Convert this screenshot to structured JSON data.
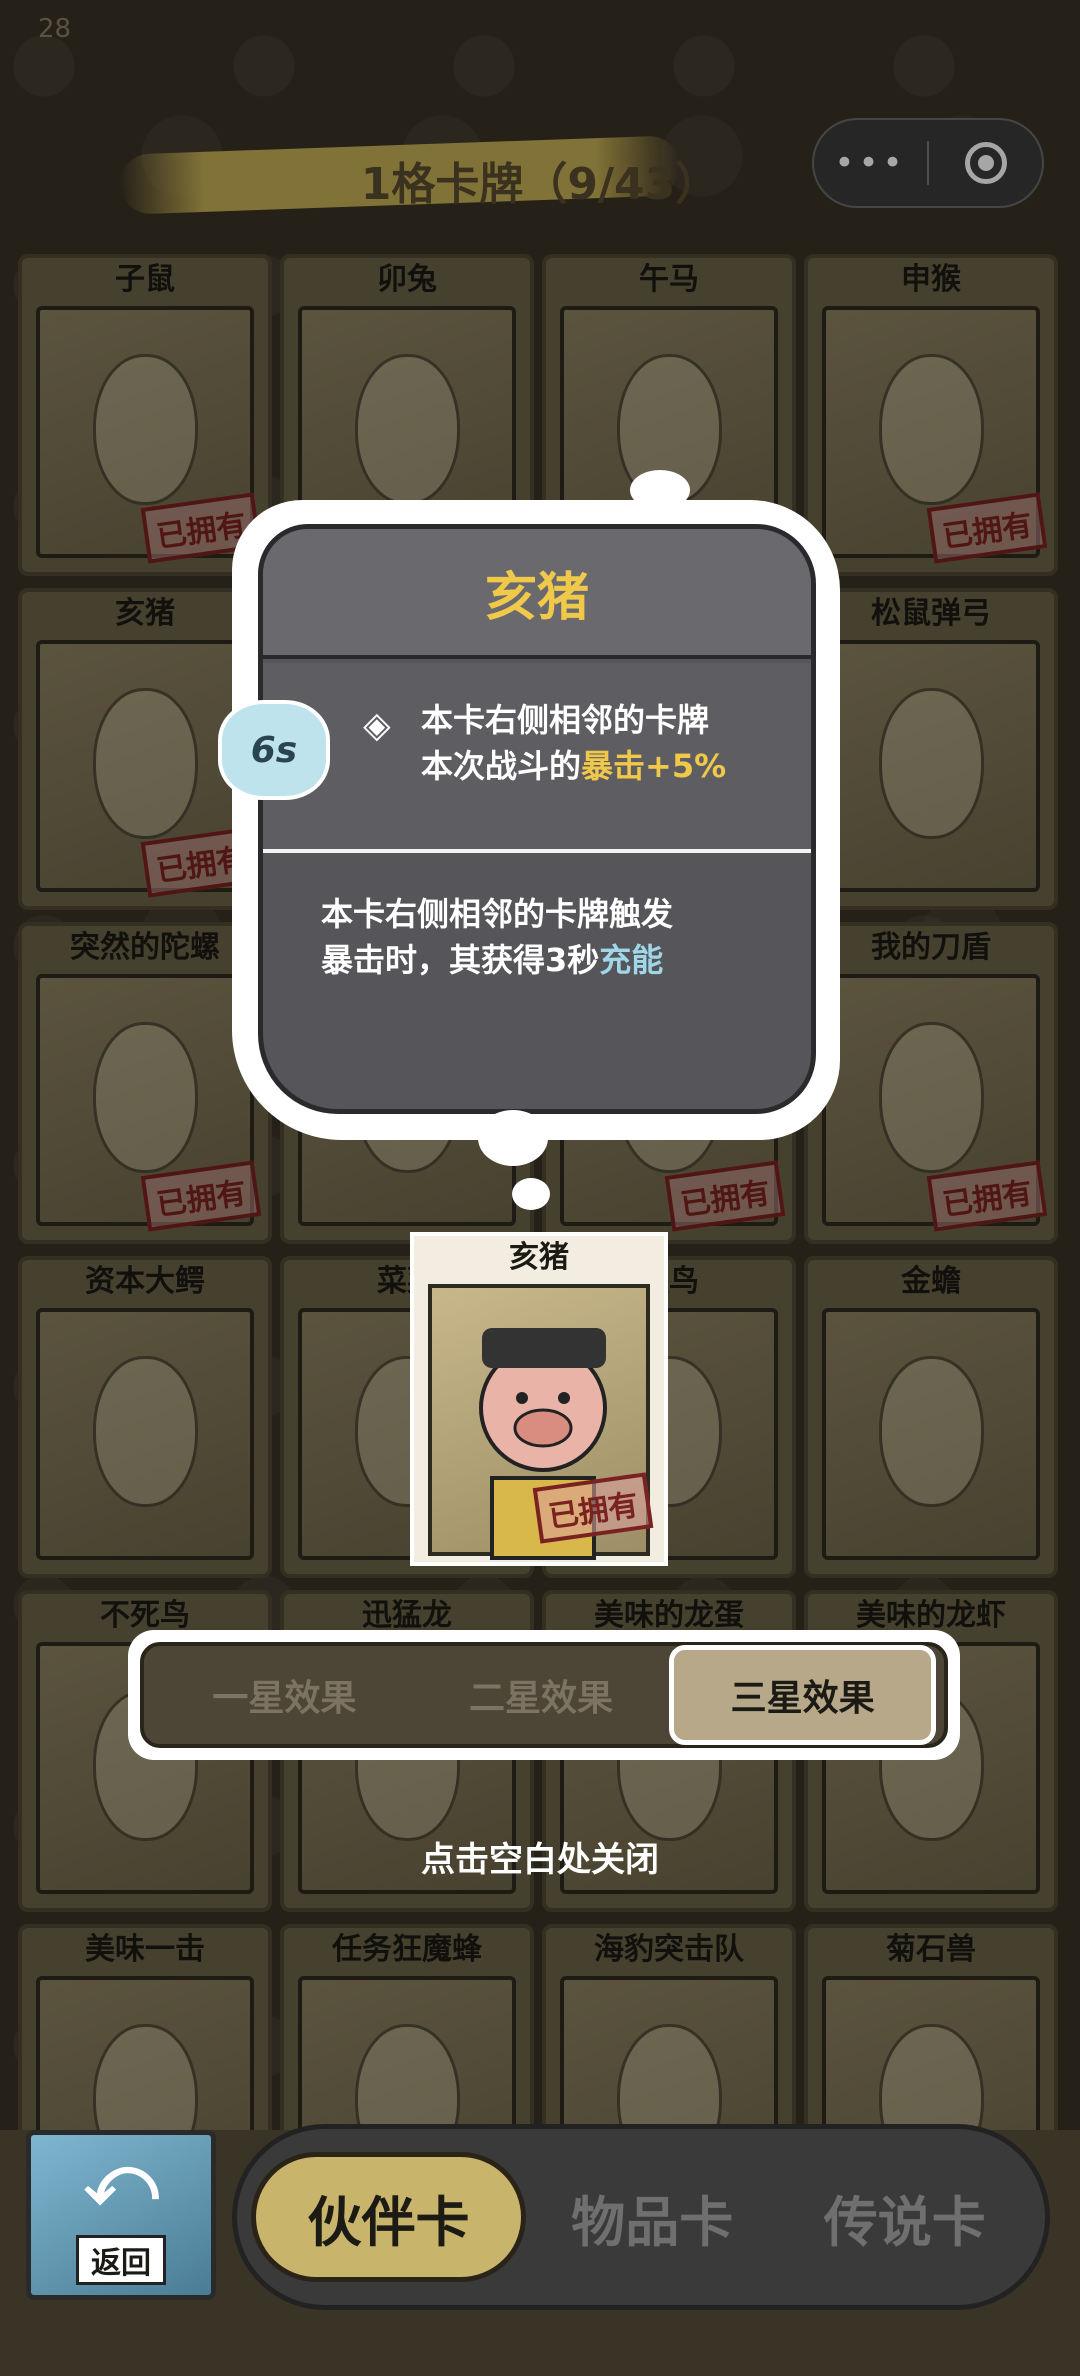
{
  "status": {
    "number": "28"
  },
  "header": {
    "title": "1格卡牌（9/43）"
  },
  "capsule": {
    "more_glyph": "•••",
    "close_icon": "target-icon"
  },
  "cards": [
    {
      "name": "子鼠",
      "owned": true
    },
    {
      "name": "卯兔",
      "owned": false
    },
    {
      "name": "午马",
      "owned": false
    },
    {
      "name": "申猴",
      "owned": true
    },
    {
      "name": "亥猪",
      "owned": true
    },
    {
      "name": "",
      "owned": false
    },
    {
      "name": "",
      "owned": false
    },
    {
      "name": "松鼠弹弓",
      "owned": false
    },
    {
      "name": "突然的陀螺",
      "owned": true
    },
    {
      "name": "",
      "owned": false
    },
    {
      "name": "",
      "owned": true
    },
    {
      "name": "我的刀盾",
      "owned": true
    },
    {
      "name": "资本大鳄",
      "owned": false
    },
    {
      "name": "菜菜",
      "owned": false
    },
    {
      "name": "八鸟",
      "owned": false
    },
    {
      "name": "金蟾",
      "owned": false
    },
    {
      "name": "不死鸟",
      "owned": false
    },
    {
      "name": "迅猛龙",
      "owned": false
    },
    {
      "name": "美味的龙蛋",
      "owned": false
    },
    {
      "name": "美味的龙虾",
      "owned": false
    },
    {
      "name": "美味一击",
      "owned": false
    },
    {
      "name": "任务狂魔蜂",
      "owned": false
    },
    {
      "name": "海豹突击队",
      "owned": false
    },
    {
      "name": "菊石兽",
      "owned": false
    }
  ],
  "owned_label": "已拥有",
  "popup": {
    "title": "亥猪",
    "cooldown": "6s",
    "effect1_a": "本卡右侧相邻的卡牌",
    "effect1_b": "本次战斗的",
    "effect1_hl": "暴击+5%",
    "effect2_a": "本卡右侧相邻的卡牌触发",
    "effect2_b": "暴击时，其获得3秒",
    "effect2_hl": "充能"
  },
  "preview": {
    "name": "亥猪",
    "owned": "已拥有"
  },
  "star_tabs": [
    "一星效果",
    "二星效果",
    "三星效果"
  ],
  "active_star_tab": 2,
  "hint": "点击空白处关闭",
  "back": {
    "label": "返回"
  },
  "nav": {
    "items": [
      "伙伴卡",
      "物品卡",
      "传说卡"
    ],
    "active": 0
  },
  "colors": {
    "accent": "#f0c94a",
    "charge": "#9fd6e8",
    "owned_stamp": "#7a2220"
  }
}
